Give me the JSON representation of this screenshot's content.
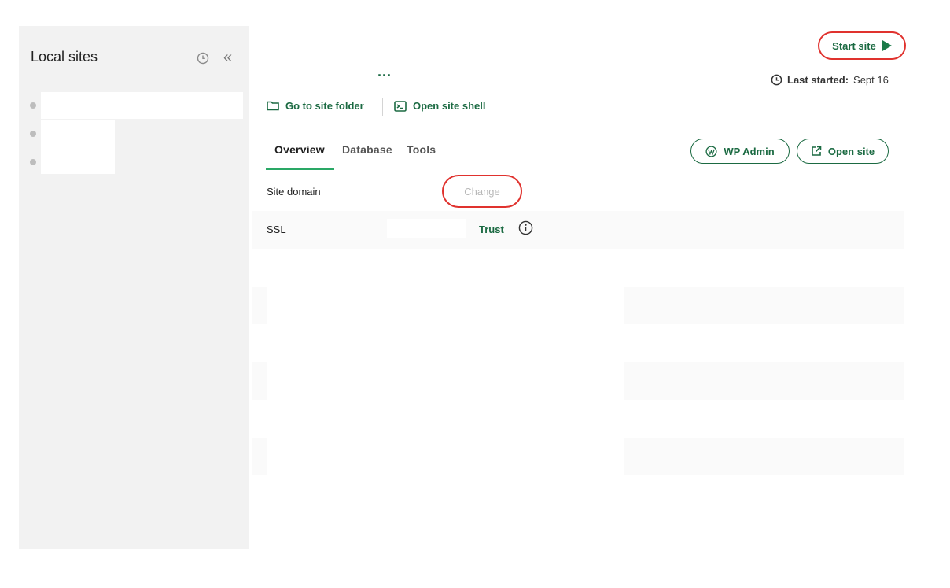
{
  "sidebar": {
    "title": "Local sites",
    "icons": [
      "clock-icon",
      "collapse-icon"
    ],
    "collapse_glyph": "«",
    "site_count": 3
  },
  "header": {
    "more_glyph": "...",
    "start_site_label": "Start site",
    "last_started_label": "Last started:",
    "last_started_value": "Sept 16"
  },
  "actions": {
    "go_to_site_folder": "Go to site folder",
    "open_site_shell": "Open site shell"
  },
  "tabs": [
    {
      "label": "Overview",
      "active": true
    },
    {
      "label": "Database",
      "active": false
    },
    {
      "label": "Tools",
      "active": false
    }
  ],
  "buttons": {
    "wp_admin": "WP Admin",
    "open_site": "Open site"
  },
  "details": {
    "site_domain_label": "Site domain",
    "change_label": "Change",
    "ssl_label": "SSL",
    "trust_label": "Trust"
  },
  "colors": {
    "accent_green": "#1b6a42",
    "tab_underline": "#2aa866",
    "highlight_red": "#e0322e",
    "sidebar_bg": "#f2f2f2"
  }
}
